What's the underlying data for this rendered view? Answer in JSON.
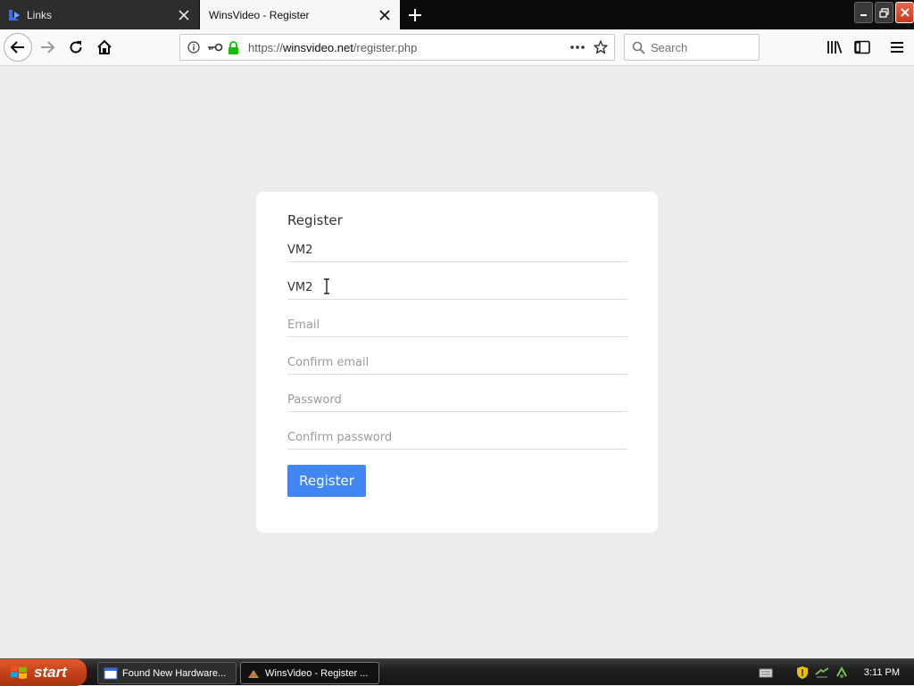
{
  "browser": {
    "tabs": [
      {
        "title": "Links"
      },
      {
        "title": "WinsVideo - Register"
      }
    ],
    "url_prefix": "https://",
    "url_domain": "winsvideo.net",
    "url_path": "/register.php",
    "search_placeholder": "Search"
  },
  "form": {
    "heading": "Register",
    "first_name_value": "VM2",
    "last_name_value": "VM2",
    "email_placeholder": "Email",
    "confirm_email_placeholder": "Confirm email",
    "password_placeholder": "Password",
    "confirm_password_placeholder": "Confirm password",
    "submit_label": "Register",
    "accent_color": "#4286f4"
  },
  "taskbar": {
    "start_label": "start",
    "items": [
      {
        "label": "Found New Hardware..."
      },
      {
        "label": "WinsVideo - Register ..."
      }
    ],
    "clock": "3:11 PM"
  }
}
